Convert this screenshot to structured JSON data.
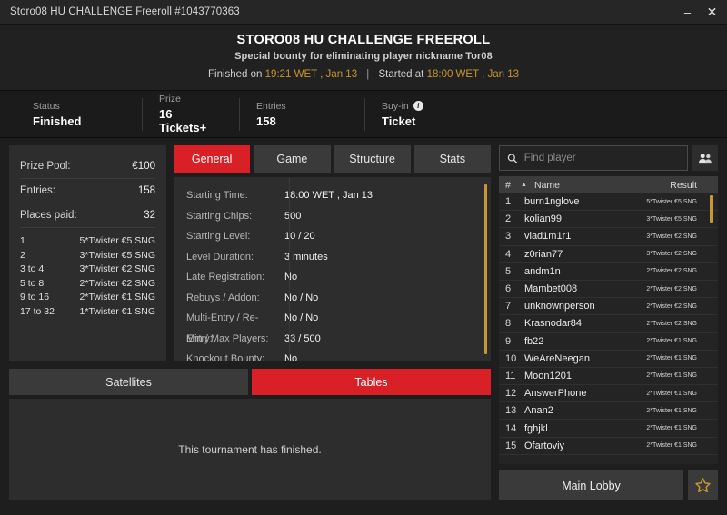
{
  "titlebar": {
    "title": "Storo08 HU CHALLENGE Freeroll #1043770363",
    "minimize_label": "–",
    "close_label": "✕"
  },
  "header": {
    "title": "STORO08 HU CHALLENGE FREEROLL",
    "subtitle": "Special bounty for eliminating player nickname Tor08",
    "finished_prefix": "Finished on",
    "finished_time": "19:21 WET , Jan 13",
    "separator": "|",
    "started_prefix": "Started at",
    "started_time": "18:00 WET , Jan 13"
  },
  "stats": [
    {
      "label": "Status",
      "value": "Finished",
      "info": false
    },
    {
      "label": "Prize",
      "value": "16 Tickets+",
      "info": false
    },
    {
      "label": "Entries",
      "value": "158",
      "info": false
    },
    {
      "label": "Buy-in",
      "value": "Ticket",
      "info": true,
      "info_glyph": "i"
    }
  ],
  "prize_panel": {
    "rows": [
      {
        "label": "Prize Pool:",
        "value": "€100"
      },
      {
        "label": "Entries:",
        "value": "158"
      },
      {
        "label": "Places paid:",
        "value": "32"
      }
    ],
    "payouts": [
      {
        "place": "1",
        "prize": "5*Twister €5 SNG"
      },
      {
        "place": "2",
        "prize": "3*Twister €5 SNG"
      },
      {
        "place": "3  to  4",
        "prize": "3*Twister €2 SNG"
      },
      {
        "place": "5  to  8",
        "prize": "2*Twister €2 SNG"
      },
      {
        "place": "9  to  16",
        "prize": "2*Twister €1 SNG"
      },
      {
        "place": "17  to  32",
        "prize": "1*Twister €1 SNG"
      }
    ]
  },
  "tabs": [
    {
      "label": "General",
      "active": true
    },
    {
      "label": "Game",
      "active": false
    },
    {
      "label": "Structure",
      "active": false
    },
    {
      "label": "Stats",
      "active": false
    }
  ],
  "details": [
    {
      "label": "Starting Time:",
      "value": "18:00 WET , Jan 13"
    },
    {
      "label": "Starting Chips:",
      "value": "500"
    },
    {
      "label": "Starting Level:",
      "value": "10 / 20"
    },
    {
      "label": "Level Duration:",
      "value": "3 minutes"
    },
    {
      "label": "Late Registration:",
      "value": "No"
    },
    {
      "label": "Rebuys / Addon:",
      "value": "No / No"
    },
    {
      "label": "Multi-Entry / Re-Entry:",
      "value": "No / No"
    },
    {
      "label": "Min / Max Players:",
      "value": "33 / 500"
    },
    {
      "label": "Knockout Bounty:",
      "value": "No"
    }
  ],
  "lower_tabs": [
    {
      "label": "Satellites",
      "active": false
    },
    {
      "label": "Tables",
      "active": true
    }
  ],
  "tables_message": "This tournament has finished.",
  "search": {
    "placeholder": "Find player",
    "value": ""
  },
  "list_header": {
    "num": "#",
    "sort_arrow": "▲",
    "name": "Name",
    "result": "Result"
  },
  "players": [
    {
      "num": "1",
      "name": "burn1nglove",
      "result": "5*Twister €5 SNG"
    },
    {
      "num": "2",
      "name": "kolian99",
      "result": "3*Twister €5 SNG"
    },
    {
      "num": "3",
      "name": "vlad1m1r1",
      "result": "3*Twister €2 SNG"
    },
    {
      "num": "4",
      "name": "z0rian77",
      "result": "3*Twister €2 SNG"
    },
    {
      "num": "5",
      "name": "andm1n",
      "result": "2*Twister €2 SNG"
    },
    {
      "num": "6",
      "name": "Mambet008",
      "result": "2*Twister €2 SNG"
    },
    {
      "num": "7",
      "name": "unknownperson",
      "result": "2*Twister €2 SNG"
    },
    {
      "num": "8",
      "name": "Krasnodar84",
      "result": "2*Twister €2 SNG"
    },
    {
      "num": "9",
      "name": "fb22",
      "result": "2*Twister €1 SNG"
    },
    {
      "num": "10",
      "name": "WeAreNeegan",
      "result": "2*Twister €1 SNG"
    },
    {
      "num": "11",
      "name": "Moon1201",
      "result": "2*Twister €1 SNG"
    },
    {
      "num": "12",
      "name": "AnswerPhone",
      "result": "2*Twister €1 SNG"
    },
    {
      "num": "13",
      "name": "Anan2",
      "result": "2*Twister €1 SNG"
    },
    {
      "num": "14",
      "name": "fghjkl",
      "result": "2*Twister €1 SNG"
    },
    {
      "num": "15",
      "name": "Ofartoviy",
      "result": "2*Twister €1 SNG"
    }
  ],
  "footer": {
    "main_lobby_label": "Main Lobby"
  },
  "colors": {
    "accent_red": "#d92027",
    "amber": "#c9962f",
    "panel": "#2d2d2d",
    "background": "#1e1e1e"
  }
}
